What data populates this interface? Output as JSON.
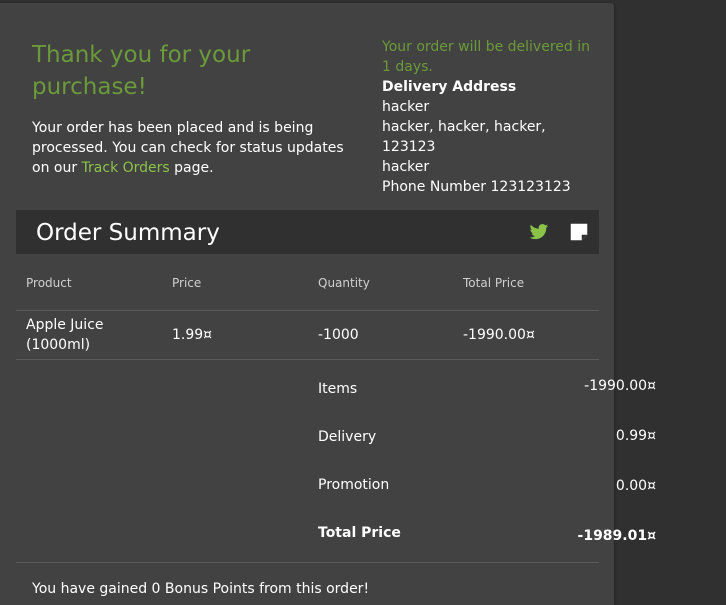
{
  "confirmation": {
    "title": "Thank you for your purchase!",
    "text_before": "Your order has been placed and is being processed. You can check for status updates on our ",
    "link": "Track Orders",
    "text_after": " page."
  },
  "delivery": {
    "note": "Your order will be delivered in 1 days.",
    "heading": "Delivery Address",
    "name": "hacker",
    "address": "hacker, hacker, hacker, 123123",
    "country": "hacker",
    "phone": "Phone Number 123123123"
  },
  "summary": {
    "title": "Order Summary",
    "icons": [
      "twitter-icon",
      "note-icon"
    ],
    "columns": [
      "Product",
      "Price",
      "Quantity",
      "Total Price"
    ],
    "rows": [
      {
        "product": "Apple Juice (1000ml)",
        "price": "1.99¤",
        "quantity": "-1000",
        "total": "-1990.00¤"
      }
    ],
    "totals": {
      "items_label": "Items",
      "items_value": "-1990.00¤",
      "delivery_label": "Delivery",
      "delivery_value": "0.99¤",
      "promotion_label": "Promotion",
      "promotion_value": "0.00¤",
      "total_label": "Total Price",
      "total_value": "-1989.01¤"
    }
  },
  "bonus": "You have gained 0 Bonus Points from this order!",
  "colors": {
    "accent": "#6b9a3a",
    "link": "#8bc34a",
    "card": "#424242",
    "background": "#303030"
  }
}
